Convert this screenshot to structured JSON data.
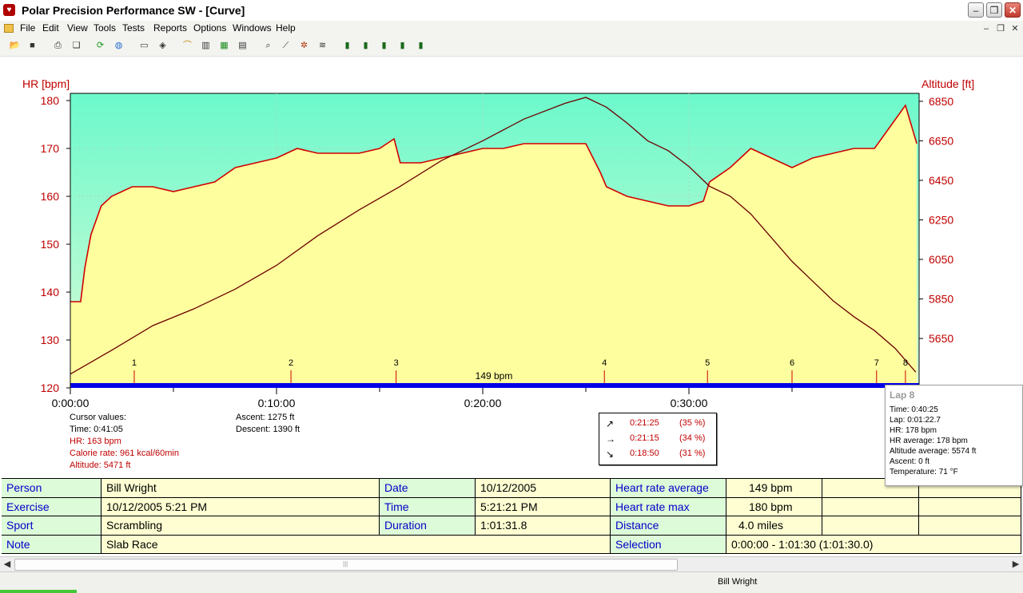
{
  "window": {
    "title": "Polar Precision Performance SW - [Curve]"
  },
  "menu": [
    "File",
    "Edit",
    "View",
    "Tools",
    "Tests",
    "Reports",
    "Options",
    "Windows",
    "Help"
  ],
  "chart_data": {
    "type": "line",
    "y_left": {
      "label": "HR [bpm]",
      "ticks": [
        "180",
        "170",
        "160",
        "150",
        "140",
        "130",
        "120"
      ],
      "range": [
        120,
        180
      ]
    },
    "y_right": {
      "label": "Altitude [ft]",
      "ticks": [
        "6850",
        "6650",
        "6450",
        "6250",
        "6050",
        "5850",
        "5650"
      ],
      "range": [
        5400,
        6890
      ]
    },
    "x": {
      "ticks": [
        "0:00:00",
        "0:10:00",
        "0:20:00",
        "0:30:00"
      ]
    },
    "hr_avg_label": "149 bpm",
    "laps": [
      "1",
      "2",
      "3",
      "4",
      "5",
      "6",
      "7",
      "8"
    ],
    "series": [
      {
        "name": "HR",
        "color": "#d00000",
        "x_min": [
          0,
          0.5,
          0.7,
          1,
          1.5,
          2,
          3,
          4,
          5,
          6,
          7,
          8,
          9,
          10,
          11,
          12,
          13,
          14,
          15,
          15.7,
          16,
          17,
          18,
          19,
          20,
          21,
          22,
          23,
          24,
          25,
          25.7,
          26,
          27,
          28,
          29,
          30,
          30.7,
          31,
          32,
          33,
          34,
          35,
          36,
          37,
          38,
          39,
          40,
          40.5,
          41.05
        ],
        "bpm": [
          138,
          138,
          145,
          152,
          158,
          160,
          162,
          162,
          161,
          162,
          163,
          166,
          167,
          168,
          170,
          169,
          169,
          169,
          170,
          172,
          167,
          167,
          168,
          169,
          170,
          170,
          171,
          171,
          171,
          171,
          165,
          162,
          160,
          159,
          158,
          158,
          159,
          163,
          166,
          170,
          168,
          166,
          168,
          169,
          170,
          170,
          176,
          179,
          171
        ]
      },
      {
        "name": "Altitude",
        "color": "#6b0000",
        "x_min": [
          0,
          2,
          4,
          6,
          8,
          10,
          12,
          14,
          16,
          18,
          20,
          22,
          24,
          25,
          26,
          27,
          28,
          29,
          30,
          31,
          32,
          33,
          34,
          35,
          36,
          37,
          38,
          39,
          40,
          41
        ],
        "ft": [
          5470,
          5590,
          5715,
          5800,
          5900,
          6020,
          6170,
          6300,
          6420,
          6550,
          6650,
          6760,
          6840,
          6870,
          6820,
          6740,
          6650,
          6600,
          6520,
          6420,
          6370,
          6280,
          6160,
          6040,
          5940,
          5840,
          5760,
          5690,
          5600,
          5480
        ]
      }
    ]
  },
  "zones": [
    {
      "arrow": "↗",
      "time": "0:21:25",
      "pct": "(35 %)"
    },
    {
      "arrow": "→",
      "time": "0:21:15",
      "pct": "(34 %)"
    },
    {
      "arrow": "↘",
      "time": "0:18:50",
      "pct": "(31 %)"
    }
  ],
  "cursor": {
    "header": "Cursor values:",
    "time": "Time: 0:41:05",
    "hr": "HR: 163 bpm",
    "calorie": "Calorie rate: 961 kcal/60min",
    "altitude": "Altitude: 5471 ft"
  },
  "ascent": "Ascent: 1275 ft",
  "descent": "Descent: 1390 ft",
  "lap_popup": {
    "title": "Lap 8",
    "lines": [
      "Time: 0:40:25",
      "Lap: 0:01:22.7",
      "HR: 178 bpm",
      "HR average:  178 bpm",
      "Altitude average:  5574 ft",
      "Ascent:  0 ft",
      "Temperature: 71 °F"
    ]
  },
  "summary": {
    "person_label": "Person",
    "person": "Bill Wright",
    "exercise_label": "Exercise",
    "exercise": "10/12/2005 5:21 PM",
    "sport_label": "Sport",
    "sport": "Scrambling",
    "note_label": "Note",
    "note": "Slab Race",
    "date_label": "Date",
    "date": "10/12/2005",
    "time_label": "Time",
    "time": "5:21:21 PM",
    "duration_label": "Duration",
    "duration": "1:01:31.8",
    "hr_avg_label": "Heart rate average",
    "hr_avg": "149 bpm",
    "hr_max_label": "Heart rate max",
    "hr_max": "180 bpm",
    "distance_label": "Distance",
    "distance": "4.0 miles",
    "selection_label": "Selection",
    "selection": "0:00:00 - 1:01:30 (1:01:30.0)"
  },
  "status": {
    "user": "Bill Wright"
  }
}
